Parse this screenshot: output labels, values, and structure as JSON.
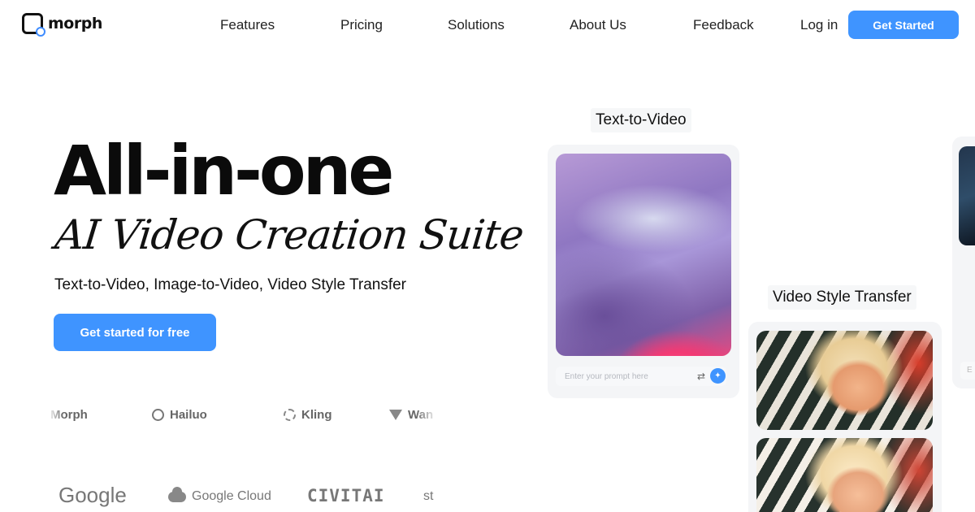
{
  "nav": {
    "brand": "morph",
    "links": [
      "Features",
      "Pricing",
      "Solutions",
      "About Us",
      "Feedback",
      "Log in"
    ],
    "cta": "Get Started"
  },
  "hero": {
    "title": "All-in-one",
    "script_title": "AI Video Creation Suite",
    "subtitle": "Text-to-Video, Image-to-Video, Video Style Transfer",
    "cta": "Get started for free"
  },
  "models": [
    "Morph",
    "Hailuo",
    "Kling",
    "Wan"
  ],
  "partners": [
    "Google",
    "Google Cloud",
    "CIVITAI",
    "st"
  ],
  "cards": {
    "text_to_video": {
      "label": "Text-to-Video",
      "prompt_placeholder": "Enter your prompt here"
    },
    "style_transfer": {
      "label": "Video Style Transfer"
    },
    "side_prompt": "E"
  },
  "icons": {
    "logo": "morph-logo-icon",
    "settings": "sliders-icon",
    "send": "sparkle-icon"
  },
  "colors": {
    "accent": "#3f94ff",
    "card_bg": "#f4f5f7",
    "text": "#111111"
  }
}
